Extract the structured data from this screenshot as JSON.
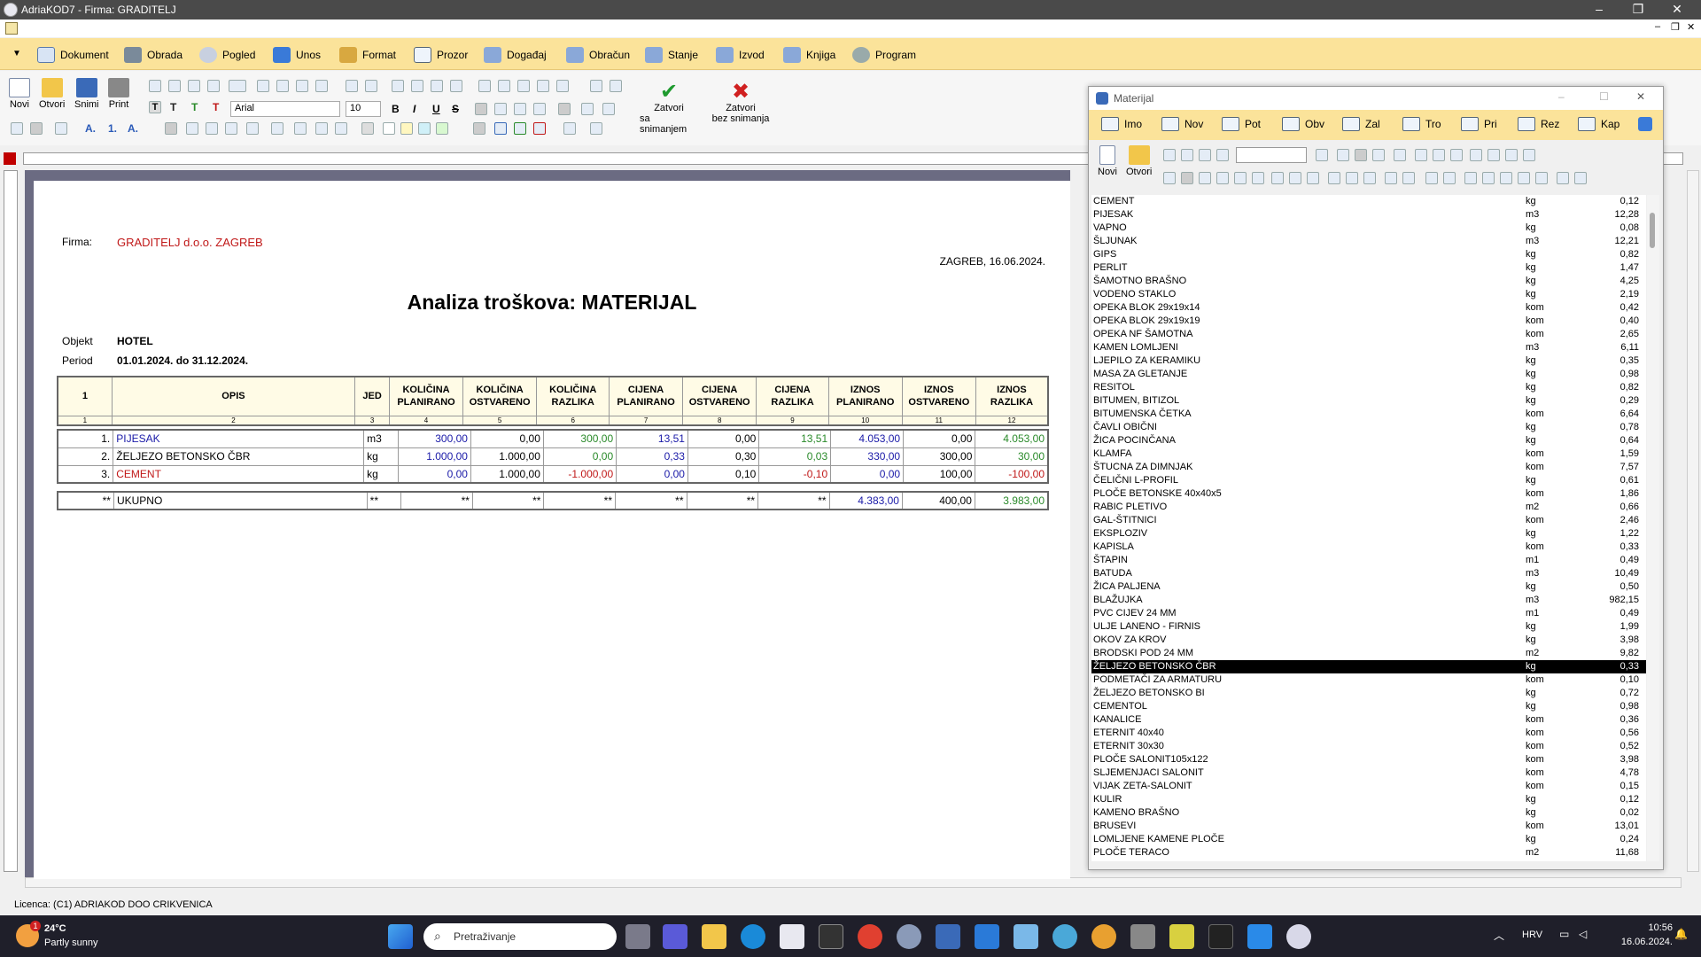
{
  "window": {
    "title": "AdriaKOD7 - Firma: GRADITELJ"
  },
  "menu": [
    "Dokument",
    "Obrada",
    "Pogled",
    "Unos",
    "Format",
    "Prozor",
    "Događaj",
    "Obračun",
    "Stanje",
    "Izvod",
    "Knjiga",
    "Program"
  ],
  "toolbar": {
    "novi": "Novi",
    "otvori": "Otvori",
    "snimi": "Snimi",
    "print": "Print",
    "font": "Arial",
    "size": "10",
    "close_save": "Zatvori\nsa snimanjem",
    "close_nosave": "Zatvori\nbez snimanja",
    "close_save_1": "Zatvori",
    "close_save_2": "sa snimanjem",
    "close_nosave_1": "Zatvori",
    "close_nosave_2": "bez snimanja"
  },
  "report": {
    "firma_label": "Firma:",
    "firma": "GRADITELJ d.o.o. ZAGREB",
    "place_date": "ZAGREB, 16.06.2024.",
    "title": "Analiza troškova: MATERIJAL",
    "objekt_label": "Objekt",
    "objekt": "HOTEL",
    "period_label": "Period",
    "period": "01.01.2024. do 31.12.2024.",
    "headers": [
      "1",
      "OPIS",
      "JED",
      "KOLIČINA PLANIRANO",
      "KOLIČINA OSTVARENO",
      "KOLIČINA RAZLIKA",
      "CIJENA PLANIRANO",
      "CIJENA OSTVARENO",
      "CIJENA RAZLIKA",
      "IZNOS PLANIRANO",
      "IZNOS OSTVARENO",
      "IZNOS RAZLIKA"
    ],
    "col_numbers": [
      "1",
      "2",
      "3",
      "4",
      "5",
      "6",
      "7",
      "8",
      "9",
      "10",
      "11",
      "12"
    ],
    "rows": [
      [
        "1.",
        "PIJESAK",
        "m3",
        "300,00",
        "0,00",
        "300,00",
        "13,51",
        "0,00",
        "13,51",
        "4.053,00",
        "0,00",
        "4.053,00"
      ],
      [
        "2.",
        "ŽELJEZO BETONSKO ČBR",
        "kg",
        "1.000,00",
        "1.000,00",
        "0,00",
        "0,33",
        "0,30",
        "0,03",
        "330,00",
        "300,00",
        "30,00"
      ],
      [
        "3.",
        "CEMENT",
        "kg",
        "0,00",
        "1.000,00",
        "-1.000,00",
        "0,00",
        "0,10",
        "-0,10",
        "0,00",
        "100,00",
        "-100,00"
      ]
    ],
    "total": [
      "**",
      "UKUPNO",
      "**",
      "**",
      "**",
      "**",
      "**",
      "**",
      "**",
      "4.383,00",
      "400,00",
      "3.983,00"
    ]
  },
  "material_window": {
    "title": "Materijal",
    "tabs": [
      "Imo",
      "Nov",
      "Pot",
      "Obv",
      "Zal",
      "Tro",
      "Pri",
      "Rez",
      "Kap"
    ],
    "novi": "Novi",
    "otvori": "Otvori",
    "items": [
      [
        "CEMENT",
        "kg",
        "0,12"
      ],
      [
        "PIJESAK",
        "m3",
        "12,28"
      ],
      [
        "VAPNO",
        "kg",
        "0,08"
      ],
      [
        "ŠLJUNAK",
        "m3",
        "12,21"
      ],
      [
        "GIPS",
        "kg",
        "0,82"
      ],
      [
        "PERLIT",
        "kg",
        "1,47"
      ],
      [
        "ŠAMOTNO BRAŠNO",
        "kg",
        "4,25"
      ],
      [
        "VODENO STAKLO",
        "kg",
        "2,19"
      ],
      [
        "OPEKA BLOK 29x19x14",
        "kom",
        "0,42"
      ],
      [
        "OPEKA BLOK 29x19x19",
        "kom",
        "0,40"
      ],
      [
        "OPEKA NF ŠAMOTNA",
        "kom",
        "2,65"
      ],
      [
        "KAMEN LOMLJENI",
        "m3",
        "6,11"
      ],
      [
        "LJEPILO ZA KERAMIKU",
        "kg",
        "0,35"
      ],
      [
        "MASA ZA GLETANJE",
        "kg",
        "0,98"
      ],
      [
        "RESITOL",
        "kg",
        "0,82"
      ],
      [
        "BITUMEN, BITIZOL",
        "kg",
        "0,29"
      ],
      [
        "BITUMENSKA ČETKA",
        "kom",
        "6,64"
      ],
      [
        "ČAVLI OBIČNI",
        "kg",
        "0,78"
      ],
      [
        "ŽICA POCINČANA",
        "kg",
        "0,64"
      ],
      [
        "KLAMFA",
        "kom",
        "1,59"
      ],
      [
        "ŠTUCNA ZA DIMNJAK",
        "kom",
        "7,57"
      ],
      [
        "ČELIČNI L-PROFIL",
        "kg",
        "0,61"
      ],
      [
        "PLOČE BETONSKE 40x40x5",
        "kom",
        "1,86"
      ],
      [
        "RABIC PLETIVO",
        "m2",
        "0,66"
      ],
      [
        "GAL-ŠTITNICI",
        "kom",
        "2,46"
      ],
      [
        "EKSPLOZIV",
        "kg",
        "1,22"
      ],
      [
        "KAPISLA",
        "kom",
        "0,33"
      ],
      [
        "ŠTAPIN",
        "m1",
        "0,49"
      ],
      [
        "BATUDA",
        "m3",
        "10,49"
      ],
      [
        "ŽICA PALJENA",
        "kg",
        "0,50"
      ],
      [
        "BLAŽUJKA",
        "m3",
        "982,15"
      ],
      [
        "PVC CIJEV 24 MM",
        "m1",
        "0,49"
      ],
      [
        "ULJE LANENO - FIRNIS",
        "kg",
        "1,99"
      ],
      [
        "OKOV ZA KROV",
        "kg",
        "3,98"
      ],
      [
        "BRODSKI POD 24 MM",
        "m2",
        "9,82"
      ],
      [
        "ŽELJEZO BETONSKO ČBR",
        "kg",
        "0,33"
      ],
      [
        "PODMETAČI ZA ARMATURU",
        "kom",
        "0,10"
      ],
      [
        "ŽELJEZO BETONSKO BI",
        "kg",
        "0,72"
      ],
      [
        "CEMENTOL",
        "kg",
        "0,98"
      ],
      [
        "KANALICE",
        "kom",
        "0,36"
      ],
      [
        "ETERNIT 40x40",
        "kom",
        "0,56"
      ],
      [
        "ETERNIT 30x30",
        "kom",
        "0,52"
      ],
      [
        "PLOČE SALONIT105x122",
        "kom",
        "3,98"
      ],
      [
        "SLJEMENJACI SALONIT",
        "kom",
        "4,78"
      ],
      [
        "VIJAK ZETA-SALONIT",
        "kom",
        "0,15"
      ],
      [
        "KULIR",
        "kg",
        "0,12"
      ],
      [
        "KAMENO BRAŠNO",
        "kg",
        "0,02"
      ],
      [
        "BRUSEVI",
        "kom",
        "13,01"
      ],
      [
        "LOMLJENE KAMENE PLOČE",
        "kg",
        "0,24"
      ],
      [
        "PLOČE TERACO",
        "m2",
        "11,68"
      ]
    ],
    "selected_index": 35
  },
  "status": {
    "licenca": "Licenca:  (C1) ADRIAKOD DOO CRIKVENICA"
  },
  "taskbar": {
    "temp": "24°C",
    "weather": "Partly sunny",
    "badge": "1",
    "search": "Pretraživanje",
    "lang": "HRV",
    "time": "10:56",
    "date": "16.06.2024."
  }
}
